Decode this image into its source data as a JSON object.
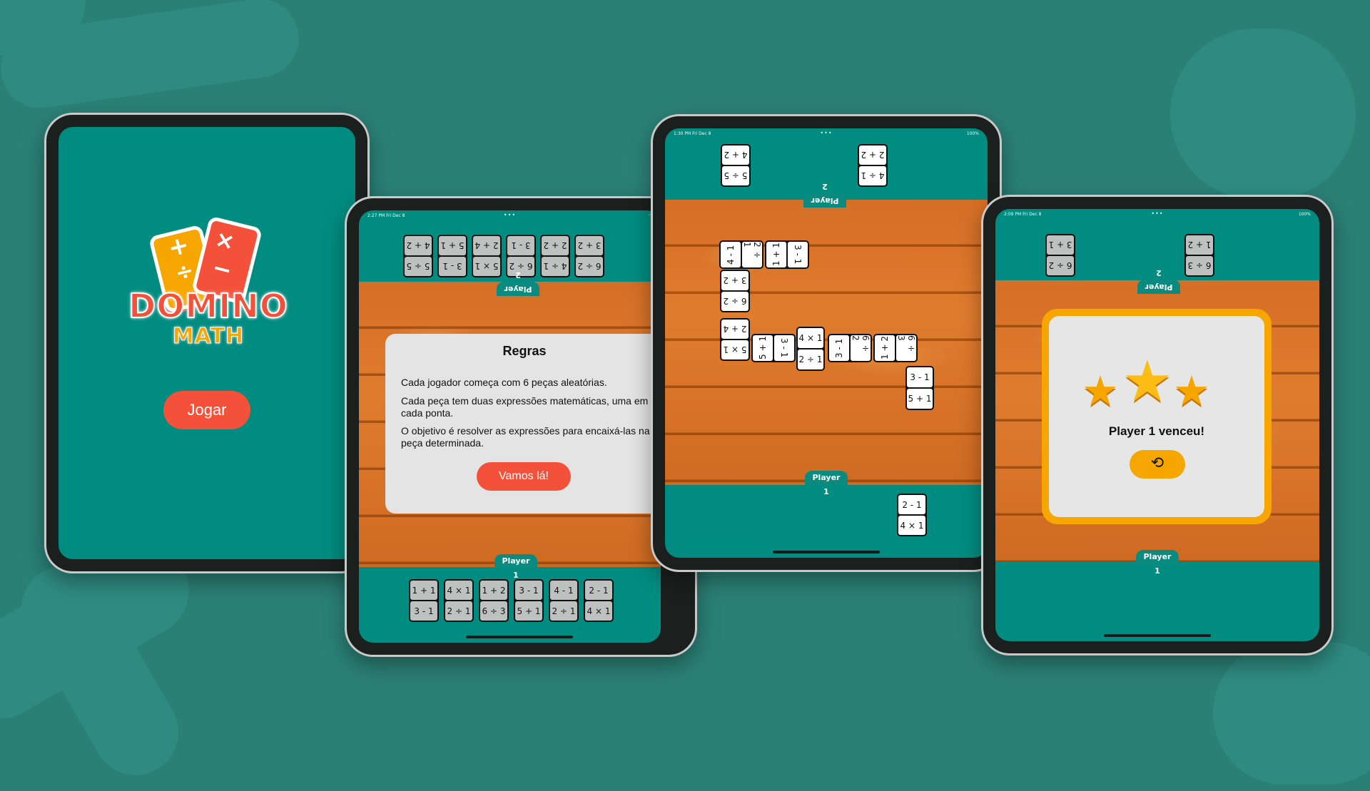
{
  "screen1": {
    "logo_top": "DOMINO",
    "logo_bottom": "MATH",
    "play_button": "Jogar"
  },
  "screen2": {
    "status_time": "2:27 PM  Fri Dec 8",
    "player2": "Player 2",
    "player1": "Player 1",
    "top_tiles": [
      [
        "5 ÷ 5",
        "4 + 2"
      ],
      [
        "3 - 1",
        "5 + 1"
      ],
      [
        "5 × 1",
        "2 + 4"
      ],
      [
        "6 ÷ 2",
        "3 - 1"
      ],
      [
        "4 ÷ 1",
        "2 + 2"
      ],
      [
        "6 ÷ 2",
        "3 + 2"
      ]
    ],
    "bottom_tiles": [
      [
        "1 + 1",
        "3 - 1"
      ],
      [
        "4 × 1",
        "2 ÷ 1"
      ],
      [
        "1 + 2",
        "6 ÷ 3"
      ],
      [
        "3 - 1",
        "5 + 1"
      ],
      [
        "4 - 1",
        "2 ÷ 1"
      ],
      [
        "2 - 1",
        "4 × 1"
      ]
    ],
    "rules_title": "Regras",
    "rules": [
      "Cada jogador começa com 6 peças aleatórias.",
      "Cada peça tem duas expressões matemáticas, uma em cada ponta.",
      "O objetivo é resolver as expressões para encaixá-las na peça determinada."
    ],
    "rules_button": "Vamos lá!"
  },
  "screen3": {
    "status_time": "1:30 PM  Fri Dec 8",
    "status_battery": "100%",
    "player2": "Player 2",
    "player1": "Player 1",
    "top_tiles": [
      [
        "5 ÷ 5",
        "4 + 2"
      ],
      [
        "4 ÷ 1",
        "2 + 2"
      ]
    ],
    "hand": [
      "2 - 1",
      "4 × 1"
    ],
    "board": {
      "row1": [
        [
          "4 - 1",
          "2 ÷ 1"
        ],
        [
          "1 + 1",
          "3 - 1"
        ]
      ],
      "col": [
        [
          "6 ÷ 2",
          "3 + 2"
        ],
        [
          "5 × 1",
          "2 + 4"
        ]
      ],
      "row2": [
        [
          "5 + 1",
          "3 - 1"
        ]
      ],
      "center": [
        "4 × 1",
        "2 ÷ 1"
      ],
      "row3": [
        [
          "3 - 1",
          "6 ÷ 2"
        ],
        [
          "1 + 2",
          "6 ÷ 3"
        ]
      ],
      "tail": [
        "3 - 1",
        "5 + 1"
      ]
    }
  },
  "screen4": {
    "status_time": "2:09 PM  Fri Dec 8",
    "status_battery": "100%",
    "player2": "Player 2",
    "player1": "Player 1",
    "top_tiles": [
      [
        "6 ÷ 2",
        "3 + 1"
      ],
      [
        "6 ÷ 3",
        "1 + 2"
      ]
    ],
    "winner": "Player 1 venceu!"
  },
  "colors": {
    "background": "#2b8076",
    "teal": "#008c80",
    "red": "#f4513a",
    "gold": "#f7a600"
  },
  "icons": {
    "replay": "replay-icon",
    "stars": "star-icon"
  }
}
